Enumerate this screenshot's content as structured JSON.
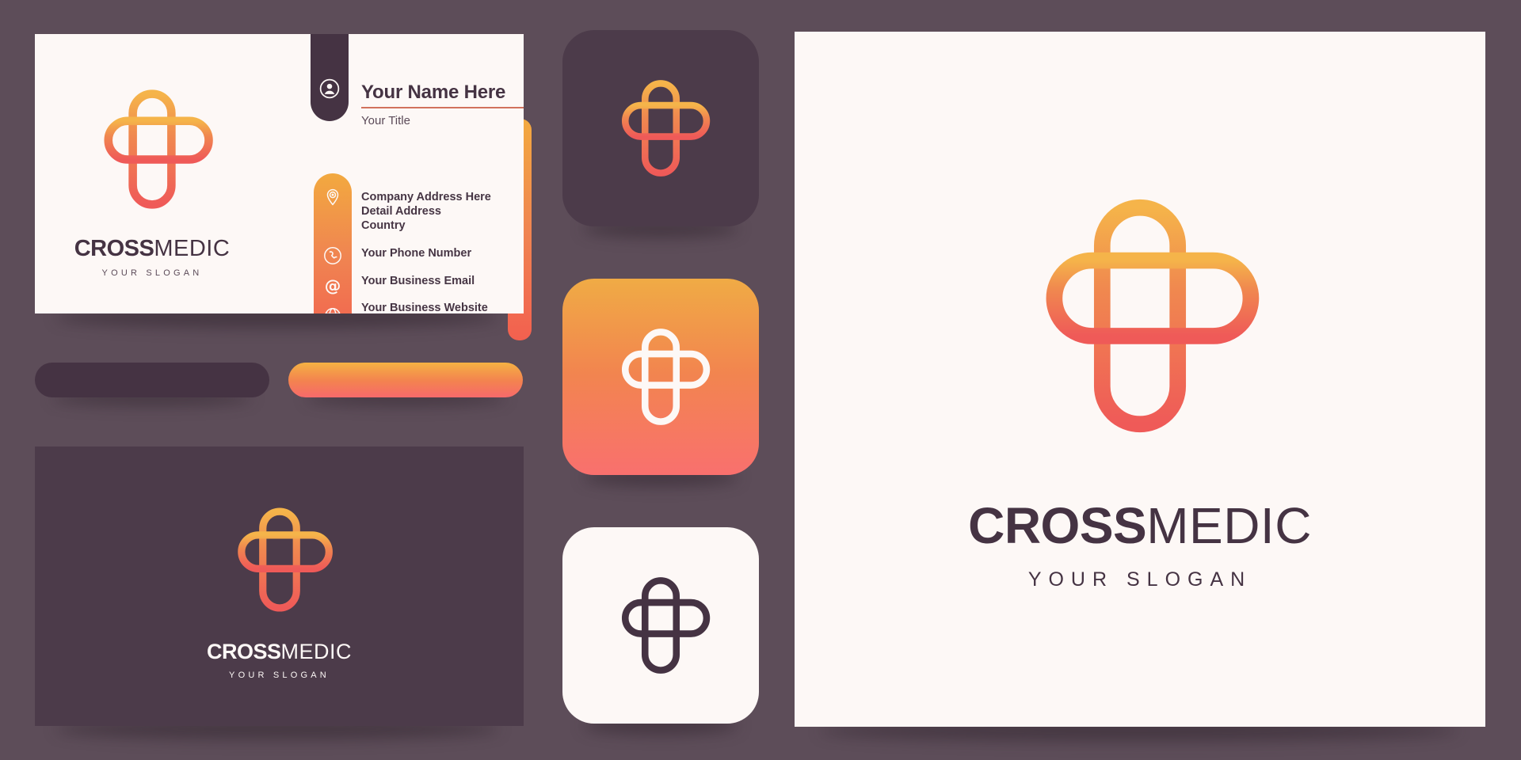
{
  "palette": {
    "background": "#5d4d59",
    "card_light": "#fdf8f6",
    "card_dark": "#4c3b4a",
    "pill_dark": "#453343",
    "accent_yellow": "#f2a93f",
    "accent_orange": "#f08551",
    "accent_red": "#f2604f",
    "rule_orange": "#d1715c",
    "text_dark": "#453343"
  },
  "brand": {
    "name_bold": "CROSS",
    "name_thin": "MEDIC",
    "slogan": "YOUR SLOGAN"
  },
  "business_card_front": {
    "person_name": "Your Name Here",
    "person_title": "Your Title",
    "person_icon": "user-icon",
    "contact": [
      {
        "icon": "location-pin-icon",
        "lines": [
          "Company Address Here",
          "Detail Address",
          "Country"
        ]
      },
      {
        "icon": "phone-icon",
        "lines": [
          "Your  Phone Number"
        ]
      },
      {
        "icon": "at-email-icon",
        "lines": [
          "Your Business Email"
        ]
      },
      {
        "icon": "globe-website-icon",
        "lines": [
          "Your Business Website"
        ]
      }
    ]
  },
  "business_card_back": {
    "name_bold": "CROSS",
    "name_thin": "MEDIC",
    "slogan": "YOUR SLOGAN"
  },
  "color_swatches": [
    {
      "label": "dark-purple-swatch",
      "color": "#453343"
    },
    {
      "label": "orange-gradient-swatch",
      "color": "#f5b243"
    }
  ],
  "icon_badges": [
    {
      "label": "dark-badge",
      "background": "#4c3b4a",
      "mark_style": "gradient"
    },
    {
      "label": "orange-badge",
      "background": "#f2854f",
      "mark_style": "white"
    },
    {
      "label": "light-badge",
      "background": "#fdf8f6",
      "mark_style": "dark"
    }
  ],
  "showcase": {
    "name_bold": "CROSS",
    "name_thin": "MEDIC",
    "slogan": "YOUR SLOGAN"
  }
}
